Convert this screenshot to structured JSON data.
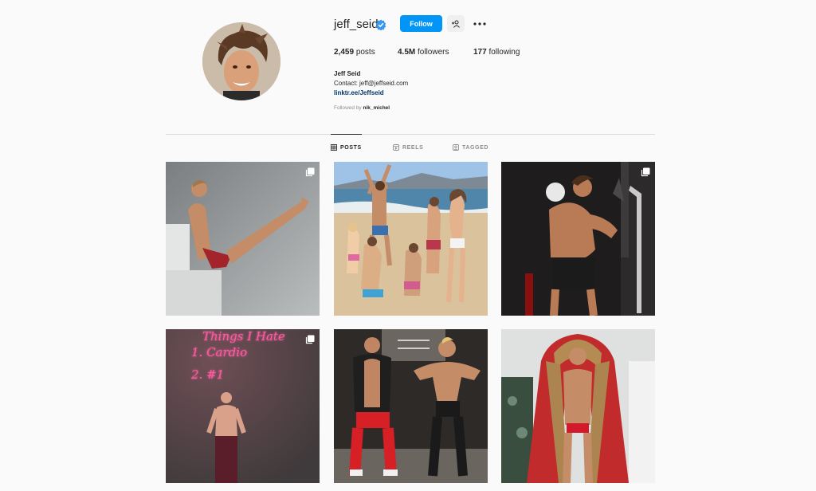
{
  "profile": {
    "username": "jeff_seid",
    "follow_label": "Follow",
    "full_name": "Jeff Seid",
    "contact": "Contact: jeff@jeffseid.com",
    "link": "linktr.ee/Jeffseid",
    "followed_prefix": "Followed by",
    "followed_by": "nik_michel"
  },
  "stats": {
    "posts_value": "2,459",
    "posts_label": "posts",
    "followers_value": "4.5M",
    "followers_label": "followers",
    "following_value": "177",
    "following_label": "following"
  },
  "tabs": [
    {
      "label": "POSTS",
      "active": true
    },
    {
      "label": "REELS",
      "active": false
    },
    {
      "label": "TAGGED",
      "active": false
    }
  ],
  "posts": [
    {
      "scene": "gym-pose-studio",
      "multi": true
    },
    {
      "scene": "beach-group",
      "multi": false
    },
    {
      "scene": "gym-cable-machine",
      "multi": true
    },
    {
      "scene": "neon-wall",
      "multi": true,
      "neon_text": [
        "Things I Hate",
        "1. Cardio",
        "2. #1"
      ]
    },
    {
      "scene": "parking-garage-duo",
      "multi": false
    },
    {
      "scene": "santa-coat",
      "multi": false
    }
  ],
  "colors": {
    "accent": "#0095f6",
    "link": "#00376b",
    "text": "#262626",
    "muted": "#8e8e8e",
    "background": "#fafafa"
  }
}
